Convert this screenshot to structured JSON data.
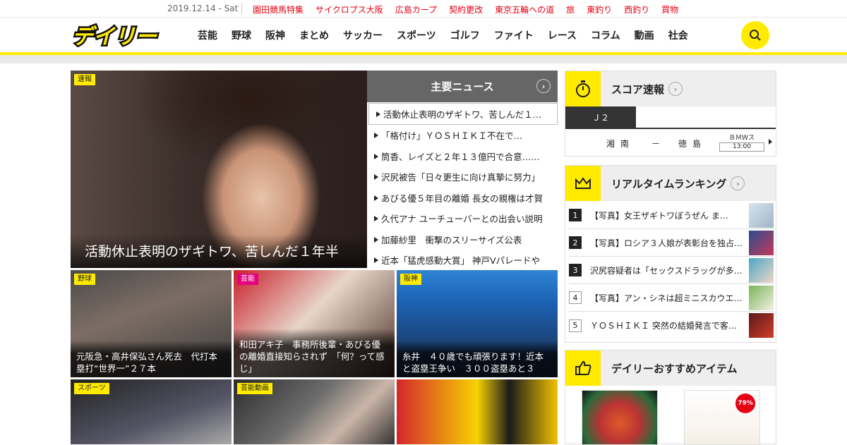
{
  "topbar": {
    "date": "2019.12.14 - Sat",
    "links": [
      "園田競馬特集",
      "サイクロプス大阪",
      "広島カープ",
      "契約更改",
      "東京五輪への道",
      "旅",
      "東釣り",
      "西釣り",
      "買物"
    ]
  },
  "header": {
    "logo": "デイリー",
    "nav": [
      "芸能",
      "野球",
      "阪神",
      "まとめ",
      "サッカー",
      "スポーツ",
      "ゴルフ",
      "ファイト",
      "レース",
      "コラム",
      "動画",
      "社会"
    ]
  },
  "hero": {
    "badge": "速報",
    "caption": "活動休止表明のザギトワ、苦しんだ１年半"
  },
  "main_news": {
    "title": "主要ニュース",
    "items": [
      "活動休止表明のザギトワ、苦しんだ１…",
      "「格付け」ＹＯＳＨＩＫＩ不在で…",
      "筒香、レイズと２年１３億円で合意……",
      "沢尻被告「日々更生に向け真摯に努力」",
      "あびる優５年目の離婚 長女の親権は才賀",
      "久代アナ ユーチューバーとの出会い説明",
      "加藤紗里　衝撃のスリーサイズ公表",
      "近本「猛虎感動大賞」 神戸Vパレードや"
    ]
  },
  "tiles": [
    {
      "badge": "野球",
      "caption": "元阪急・高井保弘さん死去　代打本塁打“世界一”２７本"
    },
    {
      "badge": "芸能",
      "caption": "和田アキ子　事務所後輩・あびる優の離婚直接知らされず　「何？って感じ」"
    },
    {
      "badge": "阪神",
      "caption": "糸井　４０歳でも頑張ります！近本と盗塁王争い　３００盗塁あと３"
    },
    {
      "badge": "スポーツ",
      "caption": ""
    },
    {
      "badge": "芸能動画",
      "caption": ""
    },
    {
      "badge": "",
      "caption": ""
    }
  ],
  "score": {
    "title": "スコア速報",
    "tab": "Ｊ２",
    "home": "湘南",
    "dash": "－",
    "away": "徳島",
    "venue": "ＢＭＷス",
    "time": "13:00"
  },
  "ranking": {
    "title": "リアルタイムランキング",
    "items": [
      {
        "num": "1",
        "text": "【写真】女王ザギトワぼうぜん ま…"
      },
      {
        "num": "2",
        "text": "【写真】ロシア３人娘が表彰台を独占…"
      },
      {
        "num": "3",
        "text": "沢尻容疑者は「セックスドラッグが多…"
      },
      {
        "num": "4",
        "text": "【写真】アン・シネは超ミニスカウエ…"
      },
      {
        "num": "5",
        "text": "ＹＯＳＨＩＫＩ 突然の結婚発言で客…"
      }
    ]
  },
  "recommend": {
    "title": "デイリーおすすめアイテム",
    "sale_badge": "79%"
  },
  "colors": {
    "accent": "#ffea00",
    "link_red": "#e60012",
    "dark": "#222222"
  }
}
